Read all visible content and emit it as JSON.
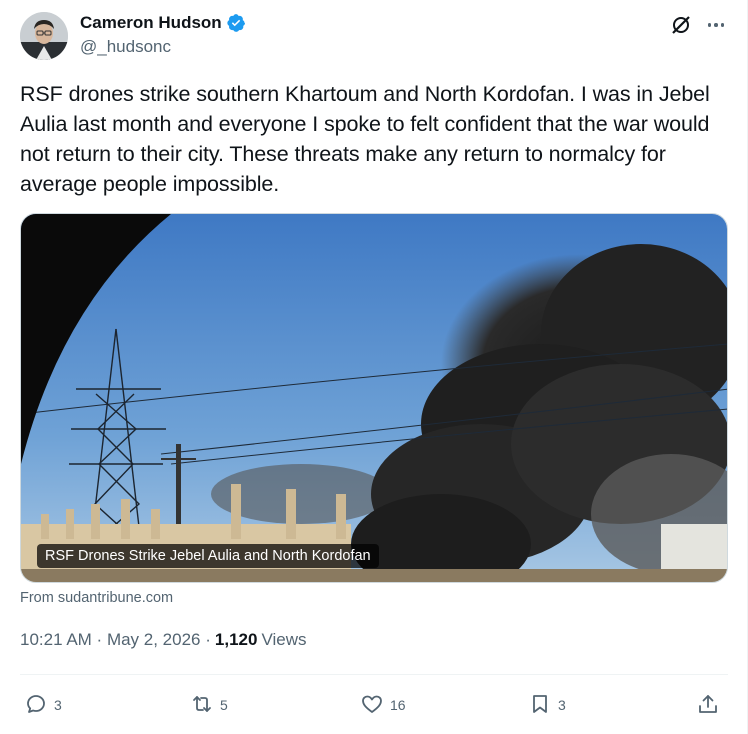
{
  "author": {
    "display_name": "Cameron Hudson",
    "handle": "@_hudsonc",
    "verified": true
  },
  "tweet": {
    "text": "RSF drones strike southern Khartoum and North Kordofan. I was in Jebel Aulia last month and everyone I spoke to felt confident that the war would not return to their city. These threats make any return to normalcy for average people impossible."
  },
  "media": {
    "caption": "RSF Drones Strike Jebel Aulia and North Kordofan",
    "source": "From sudantribune.com"
  },
  "meta": {
    "time": "10:21 AM",
    "date": "May 2, 2026",
    "views_count": "1,120",
    "views_label": "Views"
  },
  "actions": {
    "replies": "3",
    "reposts": "5",
    "likes": "16",
    "bookmarks": "3"
  },
  "colors": {
    "text_primary": "#0f1419",
    "text_secondary": "#536471",
    "verified": "#1d9bf0",
    "border": "#eff3f4"
  },
  "icons": [
    "verified-badge-icon",
    "grok-icon",
    "more-icon",
    "reply-icon",
    "repost-icon",
    "like-icon",
    "bookmark-icon",
    "share-icon"
  ]
}
